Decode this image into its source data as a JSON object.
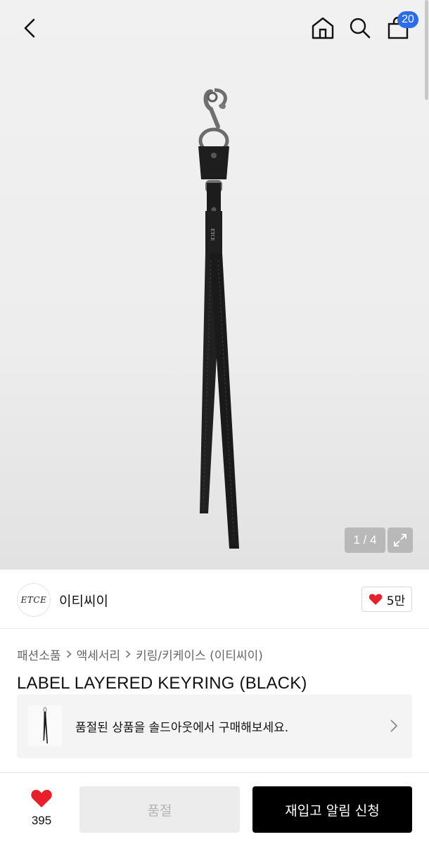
{
  "header": {
    "cart_count": "20",
    "icons": [
      "chevron-left-icon",
      "home-icon",
      "search-icon",
      "shopping-bag-icon"
    ]
  },
  "gallery": {
    "counter": "1 / 4"
  },
  "brand": {
    "logo_text": "ETCE",
    "name": "이티씨이",
    "likes": "5만"
  },
  "breadcrumb": [
    "패션소품",
    "액세서리",
    "키링/키케이스 (이티씨이)"
  ],
  "product": {
    "title": "LABEL LAYERED KEYRING (BLACK)"
  },
  "soldout_banner": {
    "text": "품절된 상품을 솔드아웃에서 구매해보세요."
  },
  "bottom_bar": {
    "wish_count": "395",
    "soldout_label": "품절",
    "restock_label": "재입고 알림 신청"
  },
  "colors": {
    "accent_badge": "#2b6de8",
    "heart": "#e8202a",
    "primary_button": "#000000"
  }
}
